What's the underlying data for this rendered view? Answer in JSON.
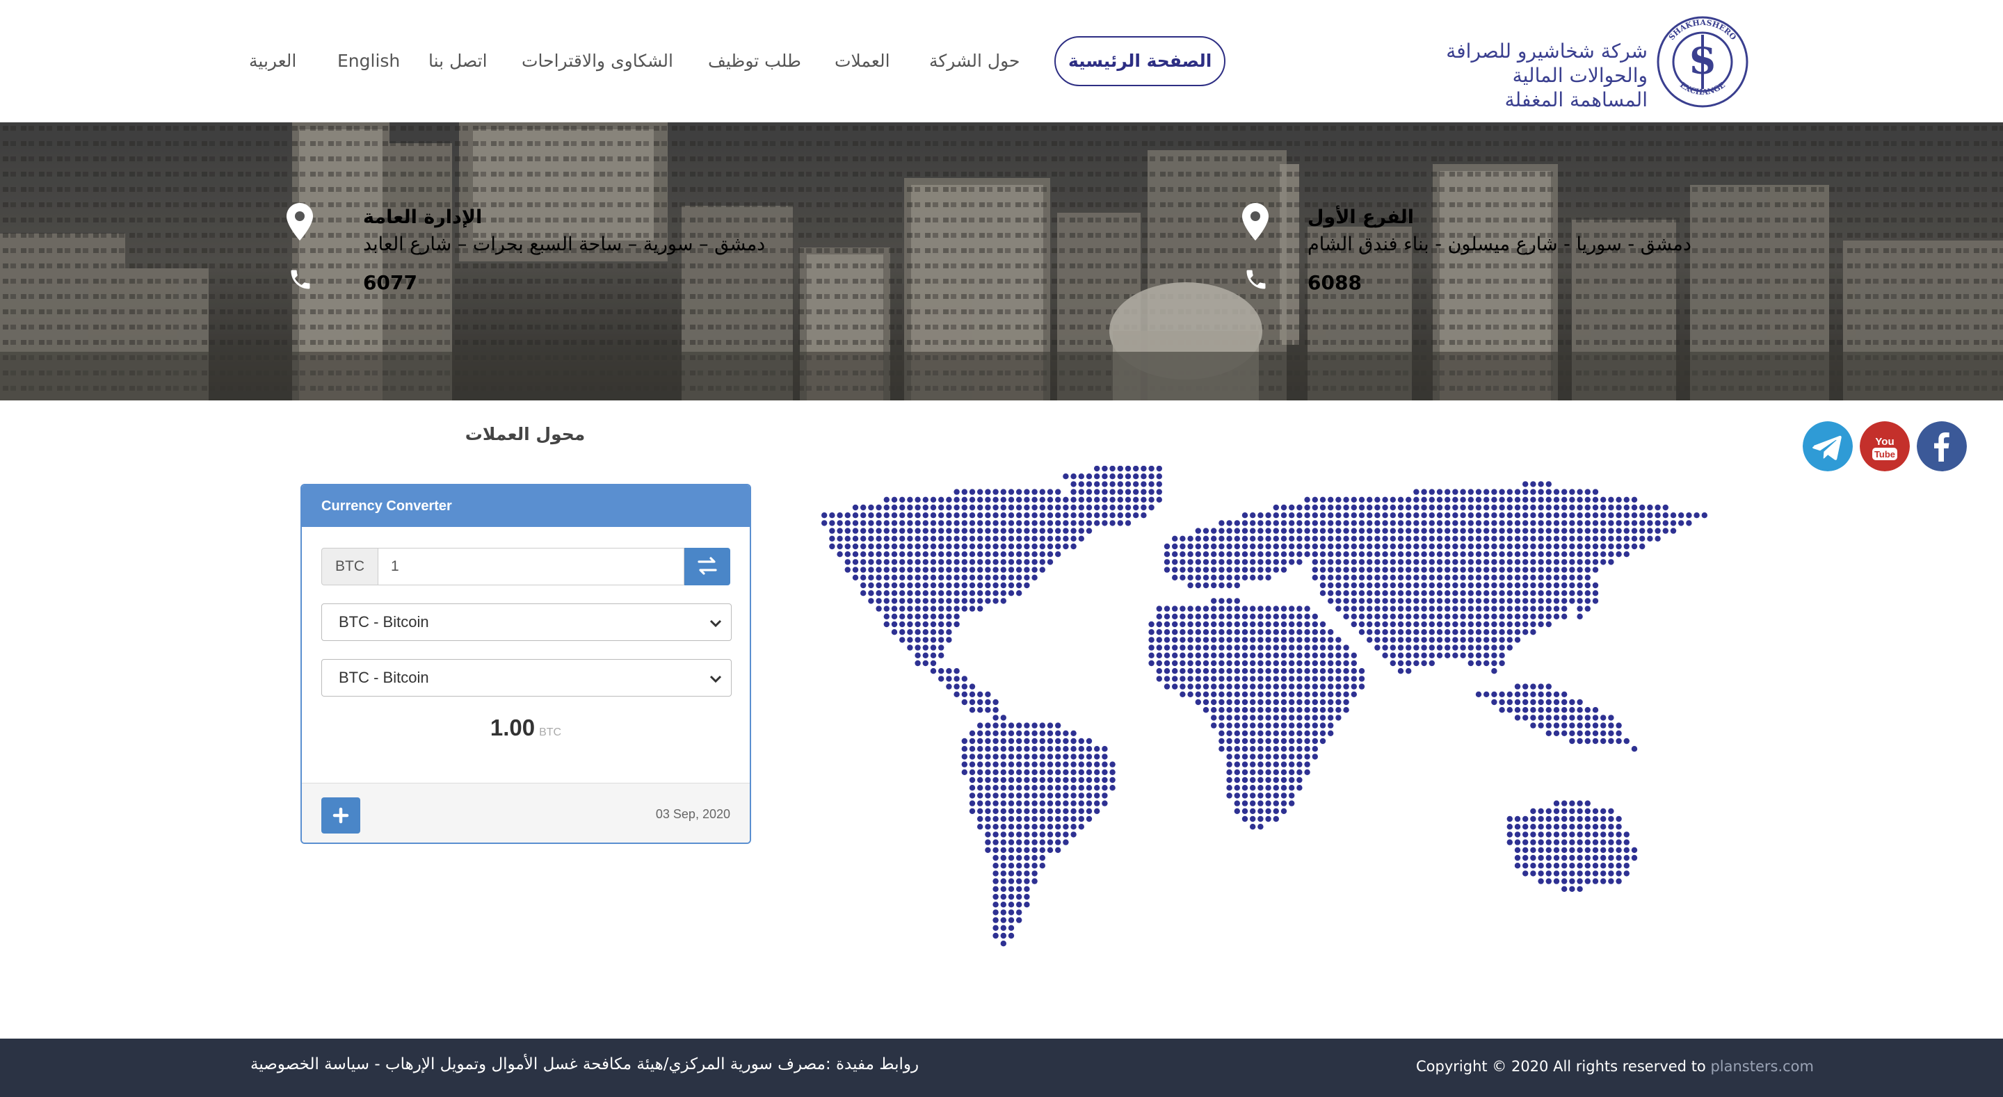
{
  "brand": {
    "name_line1": "شركة شخاشيرو للصرافة",
    "name_line2": "والحوالات المالية",
    "name_line3": "المساهمة المغفلة",
    "emblem_text": "SHAKHASHERO EXCHANGE",
    "color": "#3a3f8f"
  },
  "nav": {
    "home": "الصفحة الرئيسية",
    "about": "حول الشركة",
    "currencies": "العملات",
    "jobs": "طلب توظيف",
    "complaints": "الشكاوى والاقتراحات",
    "contact": "اتصل بنا",
    "english": "English",
    "arabic": "العربية"
  },
  "branches": {
    "first": {
      "title": "الفرع الأول",
      "address": "دمشق - سوريا - شارع ميسلون - بناء فندق الشام",
      "phone": "6088"
    },
    "hq": {
      "title": "الإدارة العامة",
      "address": "دمشق – سورية – ساحة السبع بحرات – شارع العابد",
      "phone": "6077"
    }
  },
  "social": {
    "facebook": "facebook-icon",
    "youtube": "youtube-icon",
    "telegram": "telegram-icon",
    "youtube_text_1": "You",
    "youtube_text_2": "Tube"
  },
  "converter": {
    "section_title": "محول العملات",
    "panel_title": "Currency Converter",
    "currency_code": "BTC",
    "amount": "1",
    "from_currency": "BTC - Bitcoin",
    "to_currency": "BTC - Bitcoin",
    "result_value": "1.00",
    "result_currency": "BTC",
    "date": "03 Sep, 2020"
  },
  "footer": {
    "links": "روابط مفيدة :مصرف سورية المركزي/هيئة مكافحة غسل الأموال وتمويل الإرهاب - سياسة الخصوصية",
    "copyright": "Copyright © 2020 All rights reserved to ",
    "copyright_link": "plansters.com"
  },
  "colors": {
    "accent": "#2d2e83",
    "panel_blue": "#5a8fd0",
    "button_blue": "#4a86c8",
    "map_dots": "#2e3192",
    "footer_bg": "#2b3344"
  }
}
